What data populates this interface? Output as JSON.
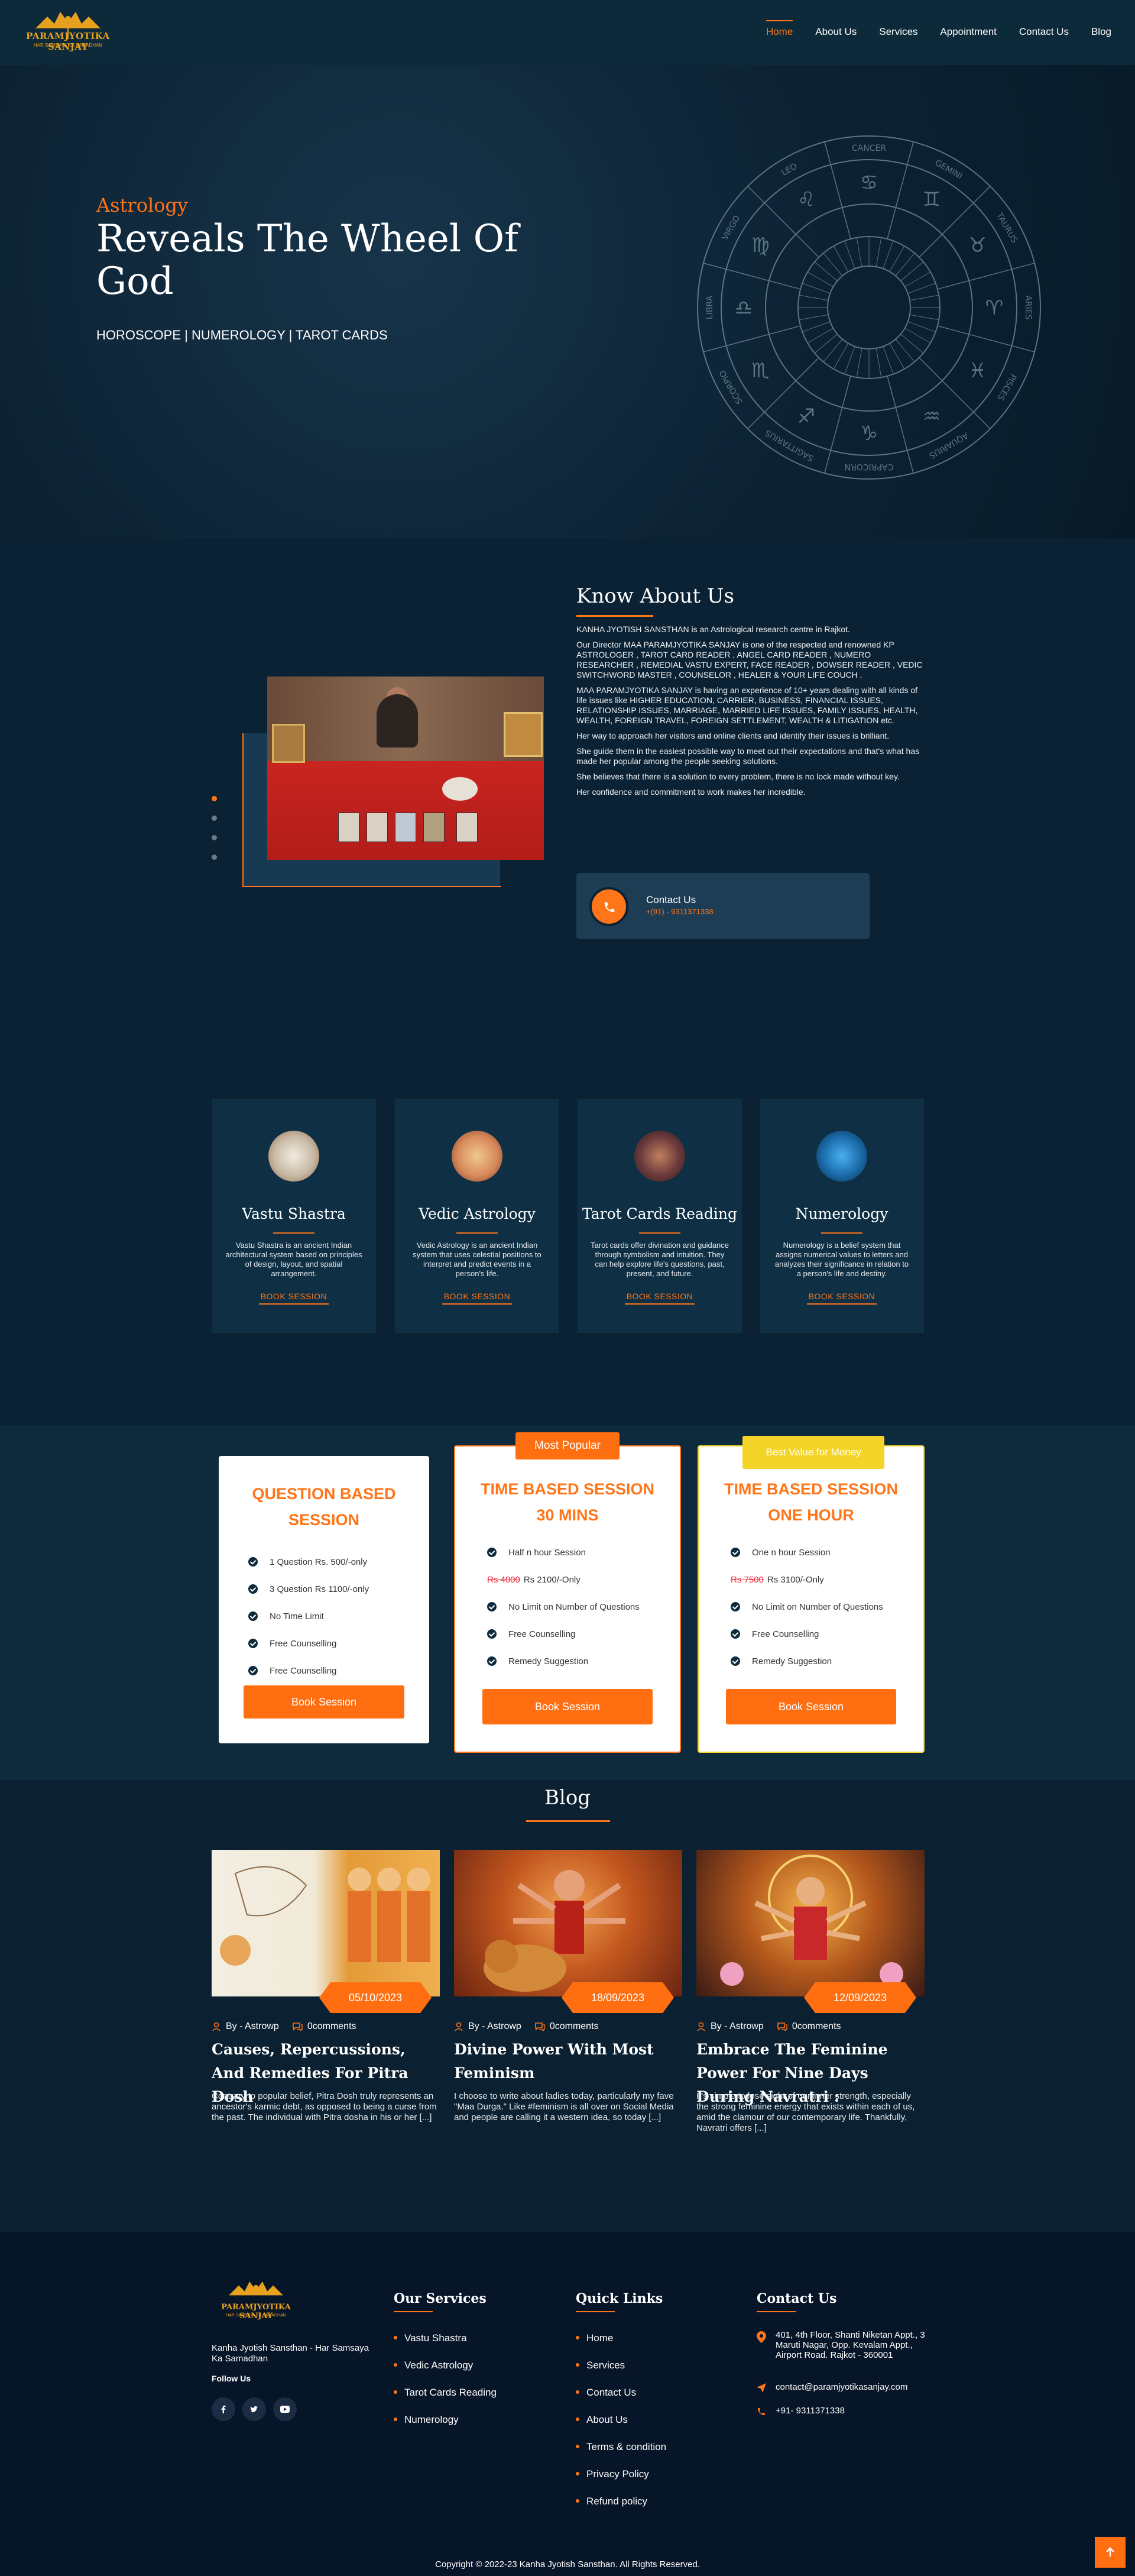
{
  "brand": {
    "name": "PARAMJYOTIKA SANJAY",
    "tagline": "HAR SAMSAYA KA SAMADHAN"
  },
  "nav": {
    "items": [
      "Home",
      "About Us",
      "Services",
      "Appointment",
      "Contact Us",
      "Blog"
    ],
    "active": "Home"
  },
  "hero": {
    "kicker": "Astrology",
    "title": "Reveals The Wheel Of God",
    "subtitle": "HOROSCOPE | NUMEROLOGY | TAROT CARDS",
    "zodiac_labels": [
      "CANCER",
      "GEMINI",
      "TAURUS",
      "ARIES",
      "PISCES",
      "AQUARIUS",
      "CAPRICORN",
      "SAGITTARIUS",
      "SCORPIO",
      "LIBRA",
      "VIRGO",
      "LEO"
    ]
  },
  "about": {
    "title": "Know About Us",
    "paragraphs": [
      "KANHA JYOTISH SANSTHAN is an Astrological research centre in Rajkot.",
      "Our Director MAA PARAMJYOTIKA SANJAY is one of the respected and renowned KP ASTROLOGER , TAROT CARD READER , ANGEL CARD READER , NUMERO RESEARCHER , REMEDIAL VASTU EXPERT, FACE READER , DOWSER READER , VEDIC SWITCHWORD MASTER , COUNSELOR , HEALER & YOUR LIFE COUCH .",
      "MAA PARAMJYOTIKA SANJAY is having an experience of 10+ years dealing with all kinds of life issues like HIGHER EDUCATION, CARRIER, BUSINESS, FINANCIAL ISSUES, RELATIONSHIP ISSUES, MARRIAGE, MARRIED LIFE ISSUES, FAMILY ISSUES, HEALTH, WEALTH, FOREIGN TRAVEL, FOREIGN SETTLEMENT, WEALTH & LITIGATION etc.",
      "Her way to approach her visitors and online clients and identify their issues is brilliant.",
      "She guide them in the easiest possible way to meet out their expectations and that's what has made her popular among the people seeking solutions.",
      "She believes that there is a solution to every problem, there is no lock made without key.",
      "Her confidence and commitment to work makes her incredible."
    ],
    "contact_label": "Contact Us",
    "contact_number": "+(91) - 9311371338"
  },
  "services": [
    {
      "title": "Vastu Shastra",
      "desc": "Vastu Shastra is an ancient Indian architectural system based on principles of design, layout, and spatial arrangement.",
      "cta": "BOOK SESSION",
      "color": "#c9b9a4"
    },
    {
      "title": "Vedic Astrology",
      "desc": "Vedic Astrology is an ancient Indian system that uses celestial positions to interpret and predict events in a person's life.",
      "cta": "BOOK SESSION",
      "color": "#d88a5a"
    },
    {
      "title": "Tarot Cards Reading",
      "desc": "Tarot cards offer divination and guidance through symbolism and intuition. They can help explore life's questions, past, present, and future.",
      "cta": "BOOK SESSION",
      "color": "#6a3a3a"
    },
    {
      "title": "Numerology",
      "desc": "Numerology is a belief system that assigns numerical values to letters and analyzes their significance in relation to a person's life and destiny.",
      "cta": "BOOK SESSION",
      "color": "#1a6aa8"
    }
  ],
  "pricing": [
    {
      "tag": "",
      "title": "QUESTION BASED SESSION",
      "features": [
        {
          "old": "",
          "text": "1 Question Rs. 500/-only"
        },
        {
          "old": "",
          "text": "3 Question Rs 1100/-only"
        },
        {
          "old": "",
          "text": "No Time Limit"
        },
        {
          "old": "",
          "text": "Free Counselling"
        },
        {
          "old": "",
          "text": "Free Counselling"
        }
      ],
      "cta": "Book Session"
    },
    {
      "tag": "Most Popular",
      "title": "TIME BASED SESSION 30 MINS",
      "features": [
        {
          "old": "",
          "text": "Half n hour Session"
        },
        {
          "old": "Rs 4000",
          "text": "Rs 2100/-Only"
        },
        {
          "old": "",
          "text": "No Limit on Number of Questions"
        },
        {
          "old": "",
          "text": "Free Counselling"
        },
        {
          "old": "",
          "text": "Remedy Suggestion"
        }
      ],
      "cta": "Book Session"
    },
    {
      "tag": "Best Value for Money",
      "title": "TIME BASED SESSION ONE HOUR",
      "features": [
        {
          "old": "",
          "text": "One n hour Session"
        },
        {
          "old": "Rs 7500",
          "text": "Rs 3100/-Only"
        },
        {
          "old": "",
          "text": "No Limit on Number of Questions"
        },
        {
          "old": "",
          "text": "Free Counselling"
        },
        {
          "old": "",
          "text": "Remedy Suggestion"
        }
      ],
      "cta": "Book Session"
    }
  ],
  "blog": {
    "title": "Blog",
    "posts": [
      {
        "date": "05/10/2023",
        "author": "By - Astrowp",
        "comments": "0comments",
        "title": "Causes, Repercussions, And Remedies For Pitra Dosh",
        "excerpt": "Contrary to popular belief, Pitra Dosh truly represents an ancestor's karmic debt, as opposed to being a curse from the past. The individual with Pitra dosha in his or her [...]"
      },
      {
        "date": "18/09/2023",
        "author": "By - Astrowp",
        "comments": "0comments",
        "title": "Divine Power With Most Feminism",
        "excerpt": "I choose to write about ladies today, particularly my fave \"Maa Durga.\" Like #feminism is all over on Social Media and people are calling it a western idea, so today [...]"
      },
      {
        "date": "12/09/2023",
        "author": "By - Astrowp",
        "comments": "0comments",
        "title": "Embrace The Feminine Power For Nine Days During Navratri :",
        "excerpt": "It's simple to lose sight of our inner strength, especially the strong feminine energy that exists within each of us, amid the clamour of our contemporary life. Thankfully, Navratri offers [...]"
      }
    ]
  },
  "footer": {
    "about": "Kanha Jyotish Sansthan - Har Samsaya Ka Samadhan",
    "follow": "Follow Us",
    "services_title": "Our Services",
    "services": [
      "Vastu Shastra",
      "Vedic Astrology",
      "Tarot Cards Reading",
      "Numerology"
    ],
    "links_title": "Quick Links",
    "links": [
      "Home",
      "Services",
      "Contact Us",
      "About Us",
      "Terms & condition",
      "Privacy Policy",
      "Refund policy"
    ],
    "contact_title": "Contact Us",
    "address": "401, 4th Floor, Shanti Niketan Appt., 3 Maruti Nagar, Opp. Kevalam Appt., Airport Road. Rajkot - 360001",
    "email": "contact@paramjyotikasanjay.com",
    "phone": "+91- 9311371338",
    "copyright": "Copyright © 2022-23 Kanha Jyotish Sansthan. All Rights Reserved."
  },
  "colors": {
    "accent": "#ff7518",
    "bg_dark": "#0b2234",
    "card": "#0f2f44",
    "footer": "#071528",
    "tag_yellow": "#f4d428"
  }
}
